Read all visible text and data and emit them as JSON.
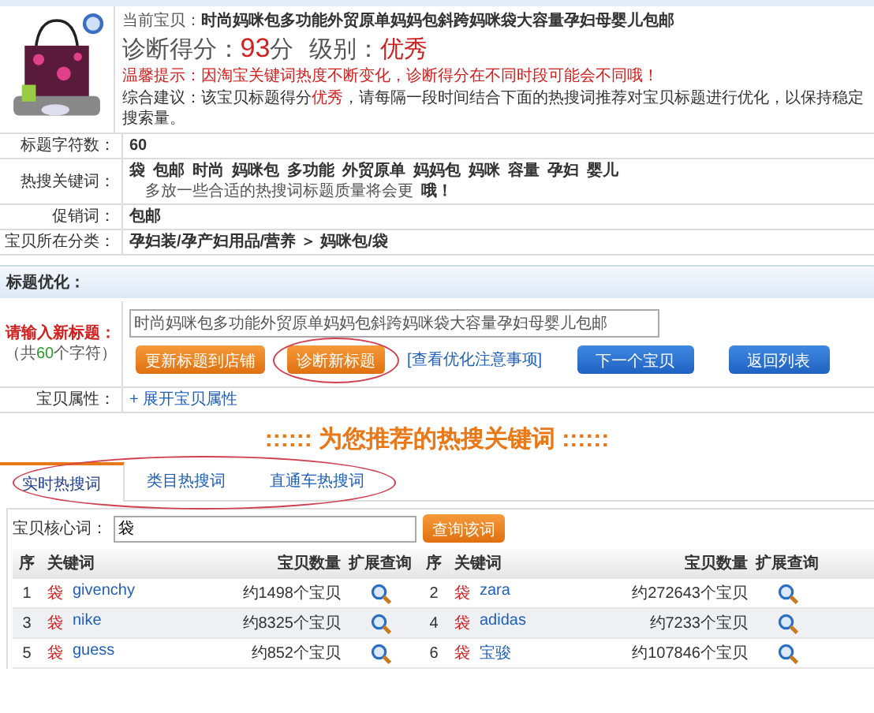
{
  "product": {
    "current_label": "当前宝贝：",
    "title": "时尚妈咪包多功能外贸原单妈妈包斜跨妈咪袋大容量孕妇母婴儿包邮",
    "score_label": "诊断得分：",
    "score": "93",
    "score_unit": "分",
    "grade_label": "级别：",
    "grade": "优秀",
    "tip": "温馨提示：因淘宝关键词热度不断变化，诊断得分在不同时段可能会不同哦！",
    "advice_prefix": "综合建议：该宝贝标题得分",
    "advice_highlight": "优秀",
    "advice_suffix": "，请每隔一段时间结合下面的热搜词推荐对宝贝标题进行优化，以保持稳定搜索量。"
  },
  "info_rows": [
    {
      "kind": "text",
      "label": "标题字符数：",
      "value": "60"
    },
    {
      "kind": "keywords",
      "label": "热搜关键词：",
      "keywords": [
        "袋",
        "包邮",
        "时尚",
        "妈咪包",
        "多功能",
        "外贸原单",
        "妈妈包",
        "妈咪",
        "容量",
        "孕妇",
        "婴儿"
      ],
      "note": "多放一些合适的热搜词标题质量将会更",
      "note_tail": "哦！"
    },
    {
      "kind": "text",
      "label": "促销词：",
      "value": "包邮"
    },
    {
      "kind": "text",
      "label": "宝贝所在分类：",
      "value": "孕妇装/孕产妇用品/营养 ＞ 妈咪包/袋"
    }
  ],
  "optimize": {
    "heading": "标题优化：",
    "input_label": "请输入新标题：",
    "count_prefix": "（共",
    "count": "60",
    "count_suffix": "个字符）",
    "title_value": "时尚妈咪包多功能外贸原单妈妈包斜跨妈咪袋大容量孕妇母婴儿包邮",
    "buttons": [
      {
        "kind": "orange",
        "label": "更新标题到店铺",
        "circled": false
      },
      {
        "kind": "orange",
        "label": "诊断新标题",
        "circled": true
      },
      {
        "kind": "link",
        "label": "[查看优化注意事项]",
        "circled": false
      },
      {
        "kind": "blue",
        "label": "下一个宝贝",
        "circled": false
      },
      {
        "kind": "blue",
        "label": "返回列表",
        "circled": false
      }
    ],
    "attr_label": "宝贝属性：",
    "attr_link": "+ 展开宝贝属性"
  },
  "recommend": {
    "heading": ":::::: 为您推荐的热搜关键词 ::::::",
    "tabs_circled": true,
    "tabs": [
      {
        "label": "实时热搜词",
        "selected": true
      },
      {
        "label": "类目热搜词",
        "selected": false
      },
      {
        "label": "直通车热搜词",
        "selected": false
      }
    ],
    "search_label": "宝贝核心词：",
    "search_value": "袋",
    "search_button": "查询该词",
    "column_groups": [
      [
        "序",
        "关键词",
        "宝贝数量",
        "扩展查询"
      ],
      [
        "序",
        "关键词",
        "宝贝数量",
        "扩展查询"
      ]
    ],
    "rows": [
      {
        "index": "1",
        "tag": "袋",
        "keyword": "givenchy",
        "count": "约1498个宝贝"
      },
      {
        "index": "2",
        "tag": "袋",
        "keyword": "zara",
        "count": "约272643个宝贝"
      },
      {
        "index": "3",
        "tag": "袋",
        "keyword": "nike",
        "count": "约8325个宝贝"
      },
      {
        "index": "4",
        "tag": "袋",
        "keyword": "adidas",
        "count": "约7233个宝贝"
      },
      {
        "index": "5",
        "tag": "袋",
        "keyword": "guess",
        "count": "约852个宝贝"
      },
      {
        "index": "6",
        "tag": "袋",
        "keyword": "宝骏",
        "count": "约107846个宝贝"
      }
    ]
  }
}
